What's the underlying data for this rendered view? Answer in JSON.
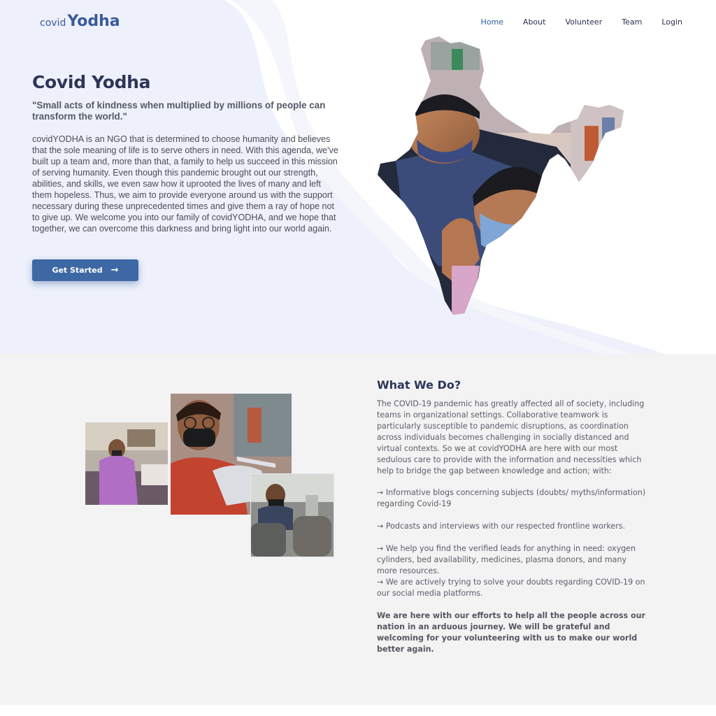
{
  "brand": {
    "logo_prefix": "covid",
    "logo_main": "Yodha"
  },
  "nav": {
    "items": [
      {
        "label": "Home",
        "active": true
      },
      {
        "label": "About"
      },
      {
        "label": "Volunteer"
      },
      {
        "label": "Team"
      },
      {
        "label": "Login"
      }
    ]
  },
  "hero": {
    "title": "Covid Yodha",
    "quote": "\"Small acts of kindness when multiplied by millions of people can transform the world.\"",
    "body": "covidYODHA is an NGO that is determined to choose humanity and believes that the sole meaning of life is to serve others in need. With this agenda, we've built up a team and, more than that, a family to help us succeed in this mission of serving humanity. Even though this pandemic brought out our strength, abilities, and skills, we even saw how it uprooted the lives of many and left them hopeless. Thus, we aim to provide everyone around us with the support necessary during these unprecedented times and give them a ray of hope not to give up. We welcome you into our family of covidYODHA, and we hope that together, we can overcome this darkness and bring light into our world again.",
    "cta_label": "Get Started",
    "cta_icon": "arrow-right-icon",
    "map_image": "india-map-masked-photo"
  },
  "what_we_do": {
    "title": "What We Do?",
    "intro": "The COVID-19 pandemic has greatly affected all of society, including teams in organizational settings. Collaborative teamwork is particularly susceptible to pandemic disruptions, as coordination across individuals becomes challenging in socially distanced and virtual contexts. So we at covidYODHA are here with our most sedulous care to provide with the information and necessities which help to bridge the gap between knowledge and action; with:",
    "bullets": [
      "Informative blogs concerning subjects (doubts/ myths/information) regarding Covid-19",
      "Podcasts and interviews with our respected frontline workers.",
      "We help you find the verified leads for anything in need: oxygen cylinders, bed availability, medicines, plasma donors, and many more resources.",
      "We are actively trying to solve your doubts regarding COVID-19 on our social media platforms."
    ],
    "bullet_glyph": "→ ",
    "closing": "We are here with our efforts to help all the people across our nation in an arduous journey. We will be grateful and welcoming for your volunteering with us to make our world better again."
  },
  "colors": {
    "accent": "#3e68a3",
    "heading": "#2e3558",
    "logo_green": "#2fa84f",
    "section_bg": "#f3f3f4",
    "hero_wave": "#eef1fb"
  }
}
